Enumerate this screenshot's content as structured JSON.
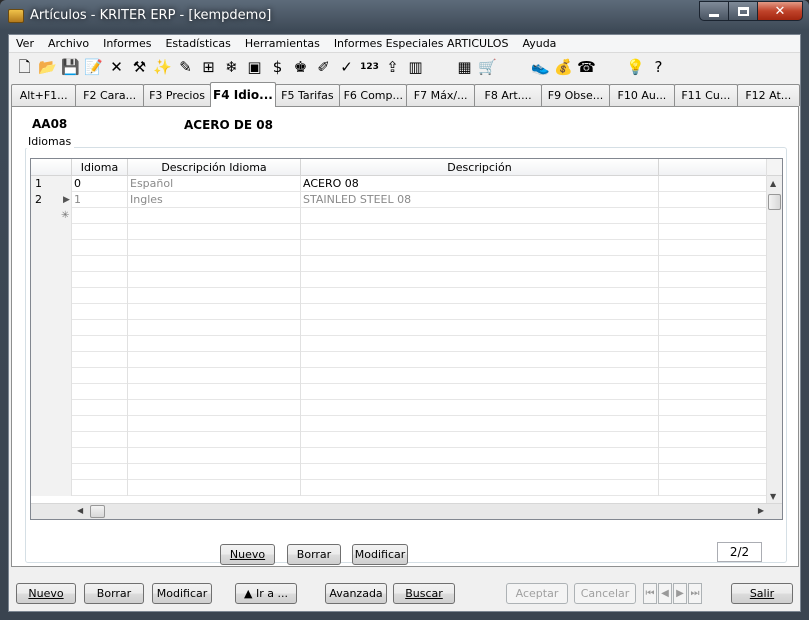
{
  "window": {
    "title": "Artículos - KRITER ERP - [kempdemo]",
    "colors": {
      "accent": "#c0432a",
      "tab_active": "#ffffff",
      "disabled_text": "#a0a0a0"
    }
  },
  "menu": [
    "Ver",
    "Archivo",
    "Informes",
    "Estadísticas",
    "Herramientas",
    "Informes Especiales ARTICULOS",
    "Ayuda"
  ],
  "toolbar": [
    {
      "icon": "new-document-icon",
      "glyph": "🗋"
    },
    {
      "icon": "open-folder-icon",
      "glyph": "📂"
    },
    {
      "icon": "save-icon",
      "glyph": "💾"
    },
    {
      "icon": "edit-icon",
      "glyph": "📝"
    },
    {
      "icon": "delete-icon",
      "glyph": "✕"
    },
    {
      "icon": "tools-icon",
      "glyph": "⚒"
    },
    {
      "icon": "wand-icon",
      "glyph": "✨"
    },
    {
      "icon": "pencil-icon",
      "glyph": "✎"
    },
    {
      "icon": "hierarchy-icon",
      "glyph": "⊞"
    },
    {
      "icon": "snowflake-icon",
      "glyph": "❄"
    },
    {
      "icon": "box-icon",
      "glyph": "▣"
    },
    {
      "icon": "dollar-icon",
      "glyph": "$"
    },
    {
      "icon": "stamp-icon",
      "glyph": "♚"
    },
    {
      "icon": "brush-icon",
      "glyph": "✐"
    },
    {
      "icon": "tag-icon",
      "glyph": "✓"
    },
    {
      "icon": "numeric-icon",
      "glyph": "123"
    },
    {
      "icon": "export-icon",
      "glyph": "⇪"
    },
    {
      "icon": "chart-icon",
      "glyph": "▥"
    },
    {
      "icon": "calculator-icon",
      "glyph": "▦"
    },
    {
      "icon": "cart-icon",
      "glyph": "🛒"
    },
    {
      "icon": "shoes-icon",
      "glyph": "👟"
    },
    {
      "icon": "money-bag-icon",
      "glyph": "💰"
    },
    {
      "icon": "phone-icon",
      "glyph": "☎"
    },
    {
      "icon": "lightbulb-icon",
      "glyph": "💡"
    },
    {
      "icon": "help-icon",
      "glyph": "?"
    }
  ],
  "tabs": [
    {
      "label": "Alt+F1...",
      "active": false
    },
    {
      "label": "F2 Cara...",
      "active": false
    },
    {
      "label": "F3 Precios",
      "active": false
    },
    {
      "label": "F4 Idio...",
      "active": true
    },
    {
      "label": "F5 Tarifas",
      "active": false
    },
    {
      "label": "F6 Comp...",
      "active": false
    },
    {
      "label": "F7 Máx/...",
      "active": false
    },
    {
      "label": "F8 Art....",
      "active": false
    },
    {
      "label": "F9 Obse...",
      "active": false
    },
    {
      "label": "F10 Au...",
      "active": false
    },
    {
      "label": "F11 Cu...",
      "active": false
    },
    {
      "label": "F12 At...",
      "active": false
    }
  ],
  "article": {
    "code": "AA08",
    "description": "ACERO DE 08"
  },
  "idiomas": {
    "group_label": "Idiomas",
    "columns": [
      "Idioma",
      "Descripción Idioma",
      "Descripción"
    ],
    "rows": [
      {
        "num": "1",
        "idioma": "0",
        "descripcion_idioma": "Español",
        "descripcion": "ACERO 08"
      },
      {
        "num": "2",
        "idioma": "1",
        "descripcion_idioma": "Ingles",
        "descripcion": "STAINLED STEEL 08"
      }
    ],
    "buttons": {
      "nuevo": "Nuevo",
      "borrar": "Borrar",
      "modificar": "Modificar"
    },
    "counter": "2/2"
  },
  "bottom_buttons": {
    "nuevo": "Nuevo",
    "borrar": "Borrar",
    "modificar": "Modificar",
    "ir_a": "▲ Ir a ...",
    "avanzada": "Avanzada",
    "buscar": "Buscar",
    "aceptar": "Aceptar",
    "cancelar": "Cancelar",
    "salir": "Salir"
  }
}
